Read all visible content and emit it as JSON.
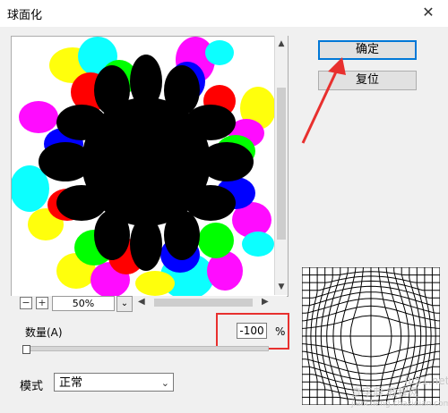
{
  "dialog": {
    "title": "球面化",
    "close_glyph": "✕"
  },
  "buttons": {
    "ok_label": "确定",
    "reset_label": "复位"
  },
  "preview": {
    "zoom_value": "50%",
    "zoom_minus": "−",
    "zoom_plus": "+"
  },
  "amount": {
    "label": "数量(A)",
    "value": "-100",
    "unit": "%",
    "slider_fraction": 0.0
  },
  "mode": {
    "label": "模式",
    "selected": "正常"
  },
  "watermark": {
    "line1": "查字典 教程网",
    "line2": "jiaocheng.chazidian.com",
    "corner": "jb51.net"
  },
  "colors": {
    "accent_blue": "#0078d7",
    "annotation_red": "#e8302e"
  }
}
